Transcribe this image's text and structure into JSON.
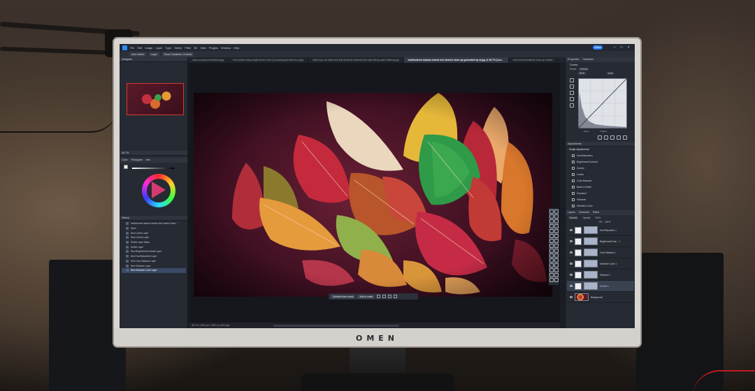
{
  "monitor": {
    "brand_logo": "OMEN"
  },
  "menubar": {
    "items": [
      "File",
      "Edit",
      "Image",
      "Layer",
      "Type",
      "Select",
      "Filter",
      "3D",
      "View",
      "Plugins",
      "Window",
      "Help"
    ],
    "share_label": "Share"
  },
  "options_bar": {
    "items": [
      "Auto-Select",
      "Layer",
      "Show Transform Controls"
    ]
  },
  "tabs": [
    {
      "label": "close-up peacock feathers.jpg",
      "active": false
    },
    {
      "label": "fresh yellow daisy single flower close up beauty generated by ai.jpg",
      "active": false
    },
    {
      "label": "milky way one light meat shit delicious oatmeal pink night sitting mate fluttering.jpg",
      "active": false
    },
    {
      "label": "multicolored autumn leaves tree branch close up generated by ai.jpg @ 48.7% (Curves 1, Layer Mask/8)",
      "active": true
    },
    {
      "label": "multi colored butterfly close up vibrant",
      "active": false
    }
  ],
  "left_panel": {
    "navigator_title": "Navigator",
    "zoom_value": "48.7%",
    "color_tabs": [
      "Color",
      "Histogram",
      "Info"
    ],
    "history_title": "History",
    "history_items": [
      "multicolored autumn leaves tree branch close-...",
      "Open",
      "New Levels Layer",
      "New Curves Layer",
      "Delete Layer Mask",
      "Delete Layer",
      "New Brightness/Contrast Layer",
      "New Hue/Saturation Layer",
      "New Color Balance Layer",
      "New Vibrance Layer",
      "New Selective Color Layer"
    ],
    "history_selected_index": 10
  },
  "canvas": {
    "status_text": "48.7% | 4000 px x 2667 px (300 ppi)",
    "context_bar": {
      "subtract_label": "Subtract from mask",
      "add_label": "Add to mask"
    }
  },
  "right_panel": {
    "properties_tabs": [
      "Properties",
      "Character"
    ],
    "curves_title": "Curves",
    "preset_label": "Preset:",
    "preset_value": "Default",
    "channel_value": "RGB",
    "auto_label": "Auto",
    "input_label": "Input:",
    "output_label": "Output:",
    "adjustments_title": "Adjustments",
    "adjust_section": "Single adjustments",
    "adjustments": [
      "Hue/Saturation",
      "Brightness/Contrast",
      "Curves",
      "Levels",
      "Color Balance",
      "Black & White",
      "Exposure",
      "Vibrance",
      "Selective Color"
    ],
    "layers_tabs": [
      "Layers",
      "Channels",
      "Paths"
    ],
    "blend_mode": "Normal",
    "opacity_label": "Opacity:",
    "opacity_value": "100%",
    "fill_label": "Fill:",
    "fill_value": "100%",
    "layers": [
      {
        "name": "Hue/Saturation 1",
        "selected": false
      },
      {
        "name": "Brightness/Contr... 1",
        "selected": false
      },
      {
        "name": "Color Balance 1",
        "selected": false
      },
      {
        "name": "Selective Color 1",
        "selected": false
      },
      {
        "name": "Vibrance 1",
        "selected": false
      },
      {
        "name": "Curves 1",
        "selected": true
      },
      {
        "name": "Background",
        "selected": false
      }
    ]
  },
  "colors": {
    "accent": "#2b7fff",
    "panel_bg": "#262a32",
    "canvas_bg": "#15171c"
  }
}
